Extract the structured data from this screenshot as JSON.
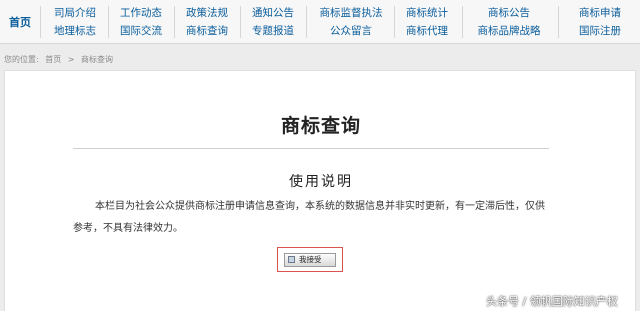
{
  "nav": {
    "home": "首页",
    "columns": [
      [
        "司局介绍",
        "地理标志"
      ],
      [
        "工作动态",
        "国际交流"
      ],
      [
        "政策法规",
        "商标查询"
      ],
      [
        "通知公告",
        "专题报道"
      ],
      [
        "商标监督执法",
        "公众留言"
      ],
      [
        "商标统计",
        "商标代理"
      ],
      [
        "商标公告",
        "商标品牌战略"
      ],
      [
        "商标申请",
        "国际注册"
      ]
    ]
  },
  "breadcrumb": {
    "prefix": "您的位置:",
    "home": "首页",
    "sep": ">",
    "current": "商标查询"
  },
  "main": {
    "title": "商标查询",
    "section_title": "使用说明",
    "description": "本栏目为社会公众提供商标注册申请信息查询，本系统的数据信息并非实时更新，有一定滞后性，仅供参考，不具有法律效力。",
    "accept_button": "我接受"
  },
  "watermark": "头条号 / 领帆国际知识产权",
  "colors": {
    "nav_link": "#0b5e9c",
    "highlight_border": "#d9534f"
  }
}
